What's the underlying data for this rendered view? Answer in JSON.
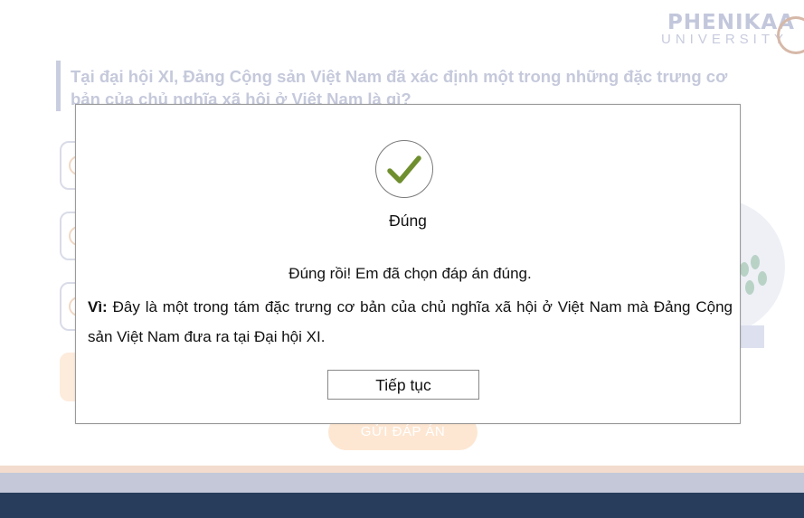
{
  "brand": {
    "name": "PHENIKAA",
    "subtitle": "UNIVERSITY"
  },
  "question": {
    "text": "Tại đại hội XI, Đảng Cộng sản Việt Nam đã xác định một trong những đặc trưng cơ bản của chủ nghĩa xã hội ở Việt Nam là gì?"
  },
  "quiz": {
    "submit_label": "GỬI ĐÁP ÁN"
  },
  "modal": {
    "status": "Đúng",
    "message": "Đúng rồi! Em đã chọn đáp án đúng.",
    "reason_prefix": "Vì:",
    "reason_text": " Đây là một trong tám đặc trưng cơ bản của chủ nghĩa xã hội ở Việt Nam mà Đảng Cộng sản Việt Nam đưa ra tại Đại hội XI.",
    "continue_label": "Tiếp tục",
    "check_icon": "check-icon"
  },
  "colors": {
    "check": "#6f8f2f",
    "footer_dark": "#283d5b",
    "accent_peach": "#fde7d3"
  }
}
